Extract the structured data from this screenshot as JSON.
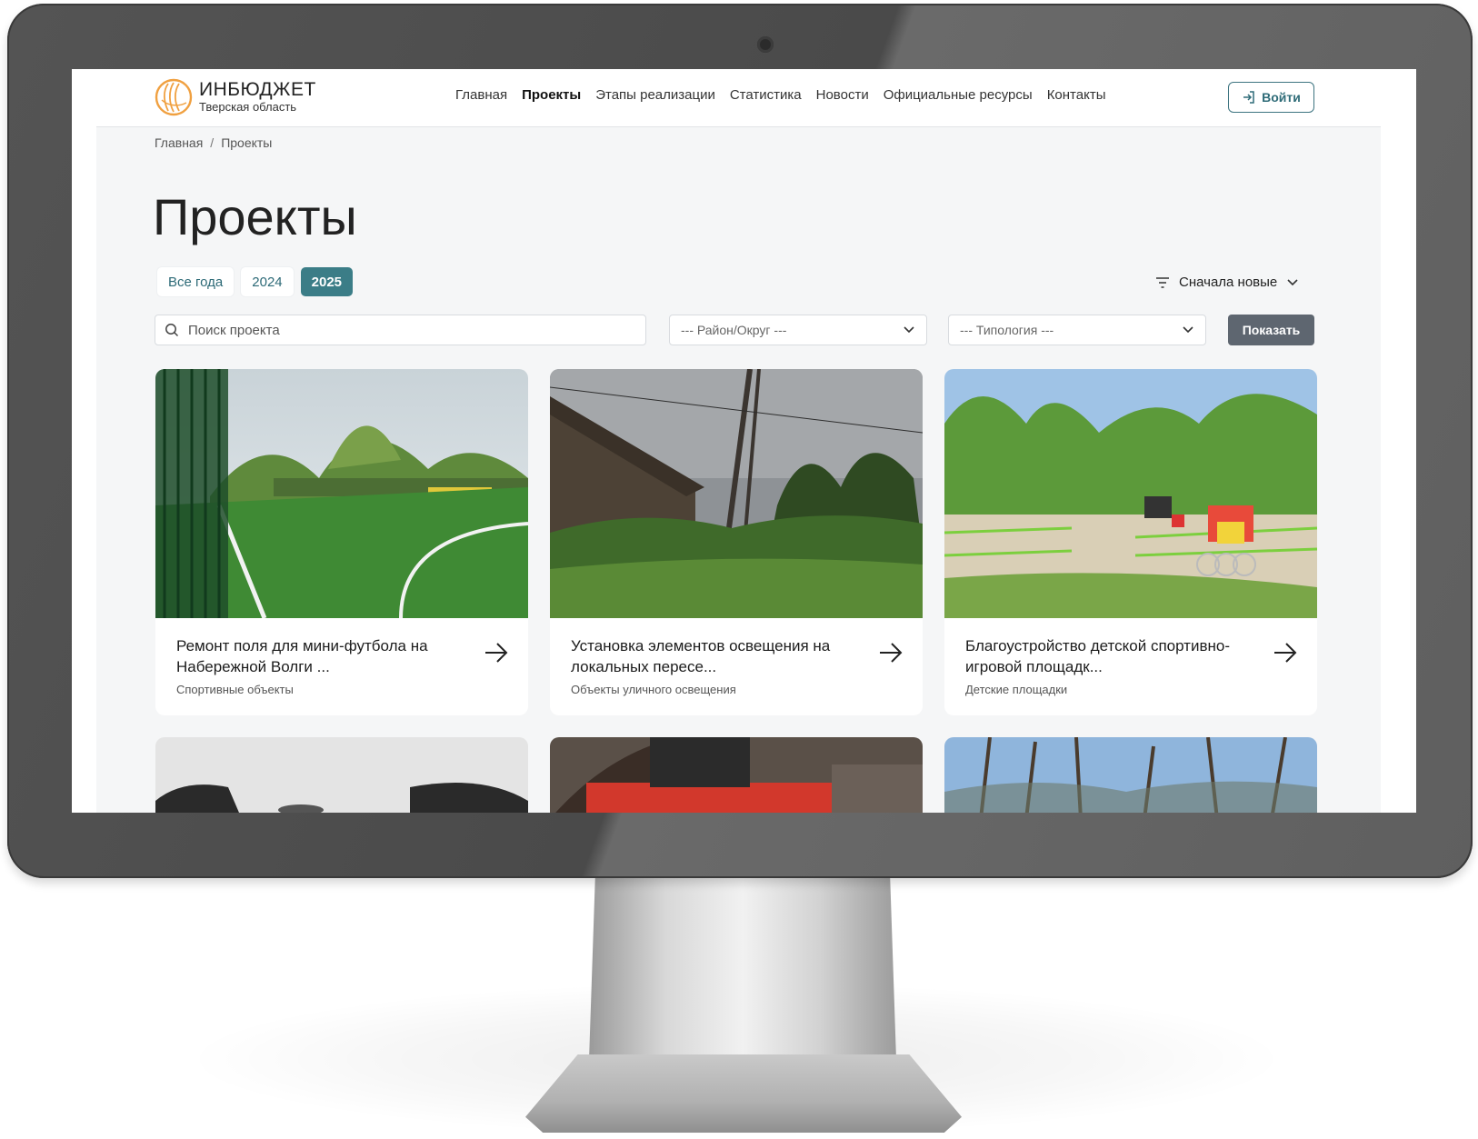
{
  "site": {
    "logo_title": "ИНБЮДЖЕТ",
    "logo_subtitle": "Тверская область"
  },
  "nav": {
    "items": [
      {
        "label": "Главная",
        "active": false
      },
      {
        "label": "Проекты",
        "active": true
      },
      {
        "label": "Этапы реализации",
        "active": false
      },
      {
        "label": "Статистика",
        "active": false
      },
      {
        "label": "Новости",
        "active": false
      },
      {
        "label": "Официальные ресурсы",
        "active": false
      },
      {
        "label": "Контакты",
        "active": false
      }
    ],
    "login_label": "Войти"
  },
  "breadcrumb": {
    "home": "Главная",
    "separator": "/",
    "current": "Проекты"
  },
  "page": {
    "title": "Проекты"
  },
  "filters": {
    "year_tabs": [
      {
        "label": "Все года",
        "active": false
      },
      {
        "label": "2024",
        "active": false
      },
      {
        "label": "2025",
        "active": true
      }
    ],
    "sort_label": "Сначала новые",
    "search_placeholder": "Поиск проекта",
    "district_select": "--- Район/Округ ---",
    "type_select": "--- Типология ---",
    "show_button": "Показать"
  },
  "projects": [
    {
      "title": "Ремонт поля для мини-футбола на Набережной Волги ...",
      "category": "Спортивные объекты",
      "image": "football-field-photo"
    },
    {
      "title": "Установка элементов освещения на локальных пересе...",
      "category": "Объекты уличного освещения",
      "image": "village-street-photo"
    },
    {
      "title": "Благоустройство детской спортивно-игровой площадк...",
      "category": "Детские площадки",
      "image": "playground-photo"
    }
  ],
  "colors": {
    "accent": "#3b7d87",
    "accent_text": "#2f6c78",
    "logo_orange": "#f0a040",
    "button_gray": "#5e6670",
    "page_bg": "#f5f6f7"
  }
}
